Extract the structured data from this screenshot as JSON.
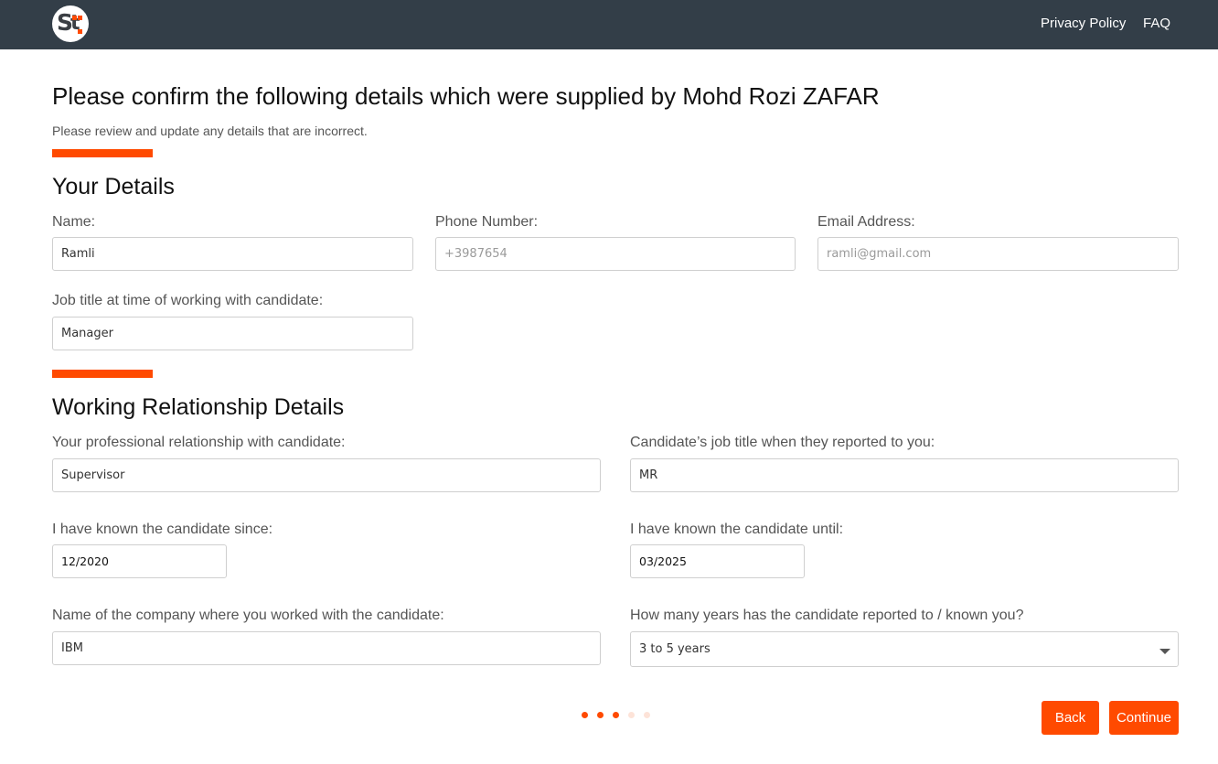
{
  "header": {
    "logo_text": "St",
    "nav": [
      "Privacy Policy",
      "FAQ"
    ],
    "background": "#333e48"
  },
  "page": {
    "title": "Please confirm the following details which were supplied by Mohd Rozi ZAFAR",
    "subtitle": "Please review and update any details that are incorrect."
  },
  "your_details": {
    "heading": "Your Details",
    "name": {
      "label": "Name:",
      "value": "Ramli"
    },
    "phone": {
      "label": "Phone Number:",
      "placeholder": "+3987654"
    },
    "email": {
      "label": "Email Address:",
      "placeholder": "ramli@gmail.com"
    },
    "job_title": {
      "label": "Job title at time of working with candidate:",
      "value": "Manager"
    }
  },
  "relationship": {
    "heading": "Working Relationship Details",
    "relationship": {
      "label": "Your professional relationship with candidate:",
      "value": "Supervisor"
    },
    "candidate_title": {
      "label": "Candidate’s job title when they reported to you:",
      "value": "MR"
    },
    "known_since": {
      "label": "I have known the candidate since:",
      "value": "12/2020"
    },
    "known_until": {
      "label": "I have known the candidate until:",
      "value": "03/2025"
    },
    "company": {
      "label": "Name of the company where you worked with the candidate:",
      "value": "IBM"
    },
    "years": {
      "label": "How many years has the candidate reported to / known you?",
      "value": "3 to 5 years"
    }
  },
  "progress": {
    "total_steps": 5,
    "completed_steps": 3
  },
  "actions": {
    "back": "Back",
    "continue": "Continue"
  },
  "colors": {
    "accent": "#ff4a00",
    "inactive_dot": "#fde3d8",
    "text": "#222222",
    "muted": "#555555"
  }
}
